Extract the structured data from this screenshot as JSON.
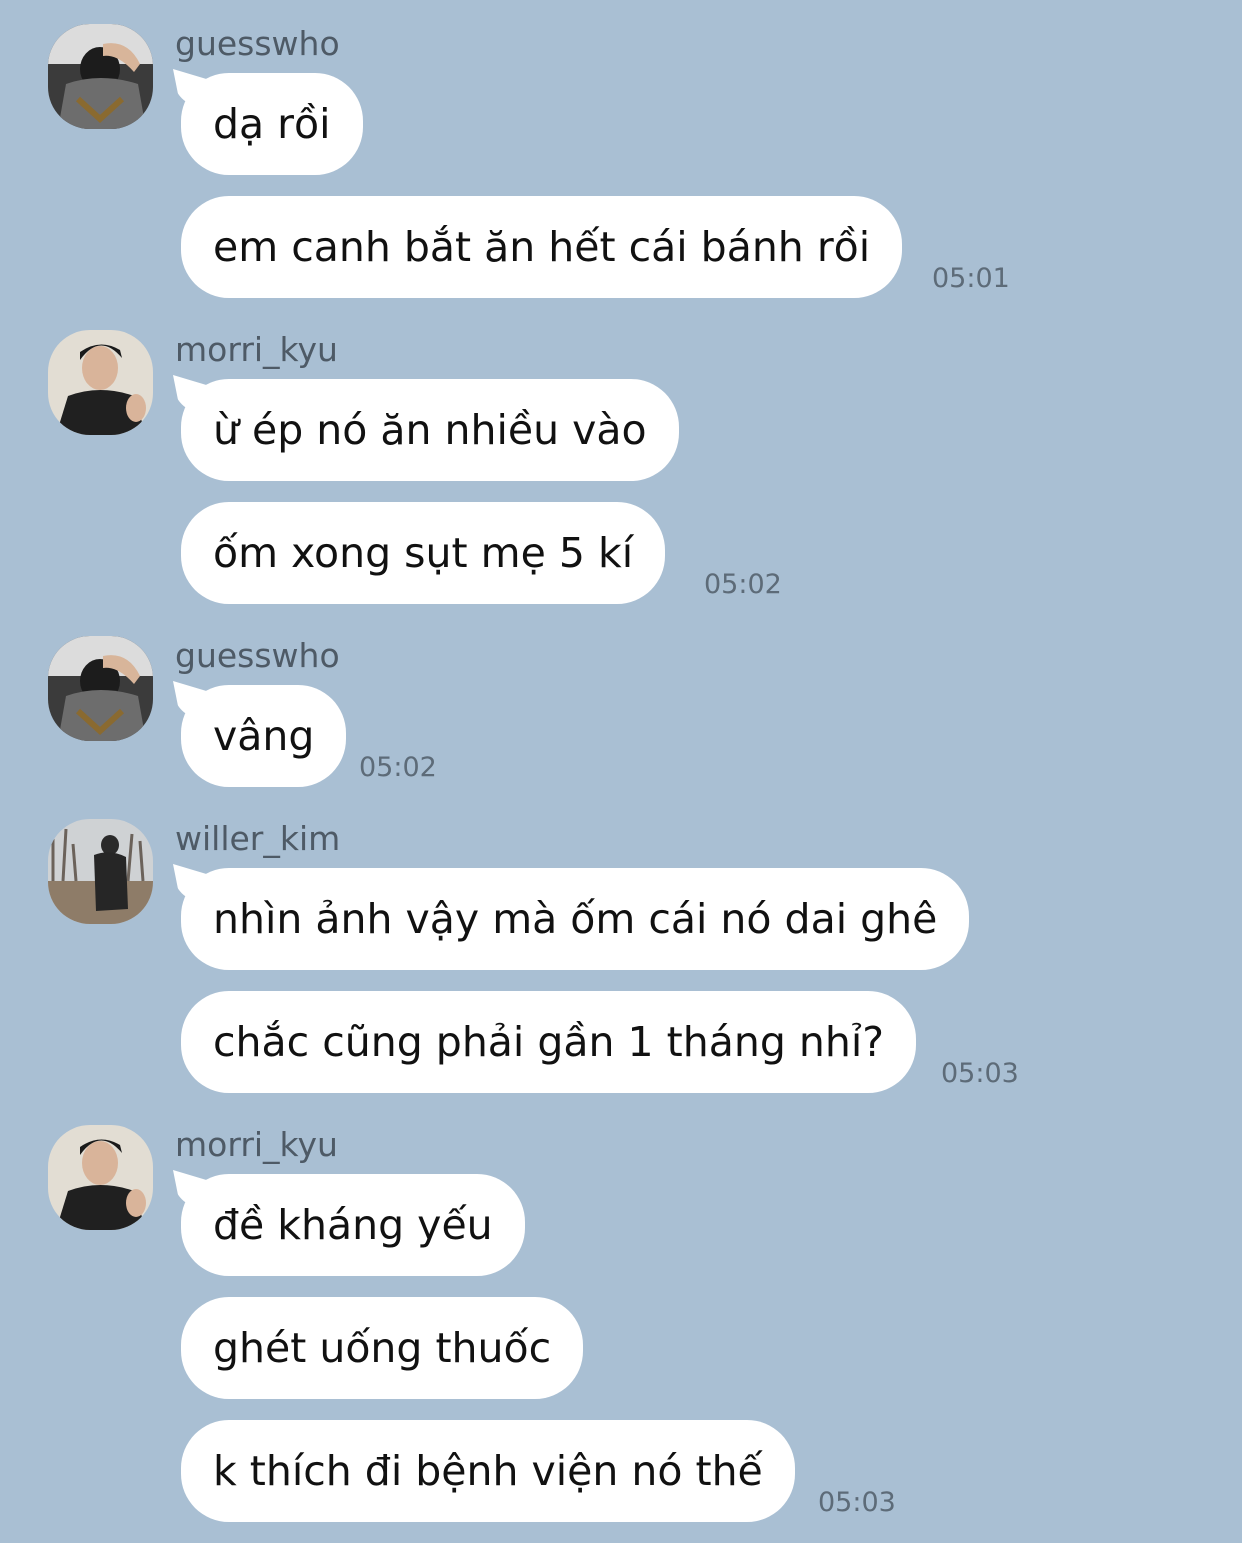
{
  "chat": {
    "groups": [
      {
        "sender": "guesswho",
        "avatar_icon": "guesswho-avatar",
        "messages": [
          "dạ rồi",
          "em canh bắt ăn hết cái bánh rồi"
        ],
        "time": "05:01"
      },
      {
        "sender": "morri_kyu",
        "avatar_icon": "morri-kyu-avatar",
        "messages": [
          "ừ ép nó ăn nhiều vào",
          "ốm xong sụt mẹ 5 kí"
        ],
        "time": "05:02"
      },
      {
        "sender": "guesswho",
        "avatar_icon": "guesswho-avatar",
        "messages": [
          "vâng"
        ],
        "time": "05:02"
      },
      {
        "sender": "willer_kim",
        "avatar_icon": "willer-kim-avatar",
        "messages": [
          "nhìn ảnh vậy mà ốm cái nó dai ghê",
          "chắc cũng phải gần 1 tháng nhỉ?"
        ],
        "time": "05:03"
      },
      {
        "sender": "morri_kyu",
        "avatar_icon": "morri-kyu-avatar",
        "messages": [
          "đề kháng yếu",
          "ghét uống thuốc",
          "k thích đi bệnh viện nó thế"
        ],
        "time": "05:03"
      }
    ]
  },
  "colors": {
    "background": "#a9bfd3",
    "bubble": "#ffffff",
    "username": "#4e5a66",
    "timestamp": "#5d6b78"
  }
}
